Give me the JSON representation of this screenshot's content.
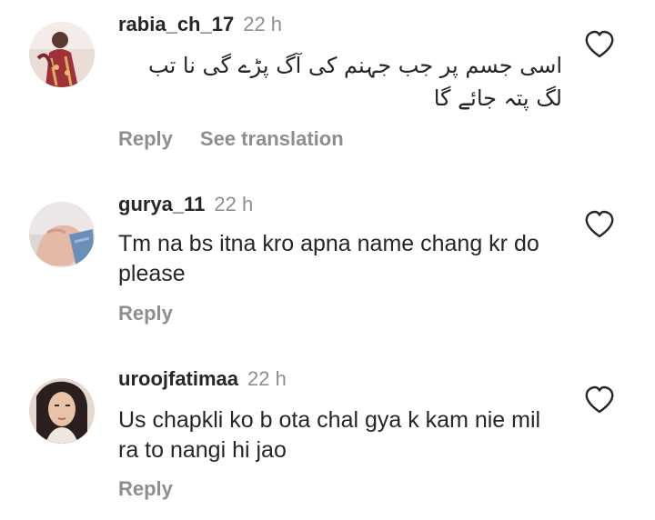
{
  "comments": [
    {
      "username": "rabia_ch_17",
      "time": "22 h",
      "text": "اسی جسم پر جب جہنم کی آگ پڑے گی نا تب لگ پتہ جائے گا",
      "reply_label": "Reply",
      "translate_label": "See translation",
      "avatar_icon": "avatar-icon"
    },
    {
      "username": "gurya_11",
      "time": "22 h",
      "text": "Tm na bs itna kro apna name chang kr do please",
      "reply_label": "Reply",
      "avatar_icon": "avatar-icon"
    },
    {
      "username": "uroojfatimaa",
      "time": "22 h",
      "text": "Us chapkli ko b ota chal gya k kam nie mil ra to nangi hi jao",
      "reply_label": "Reply",
      "avatar_icon": "avatar-icon"
    }
  ],
  "colors": {
    "text": "#262626",
    "secondary": "#8e8e8e",
    "background": "#ffffff"
  },
  "icons": {
    "like": "heart-icon"
  }
}
